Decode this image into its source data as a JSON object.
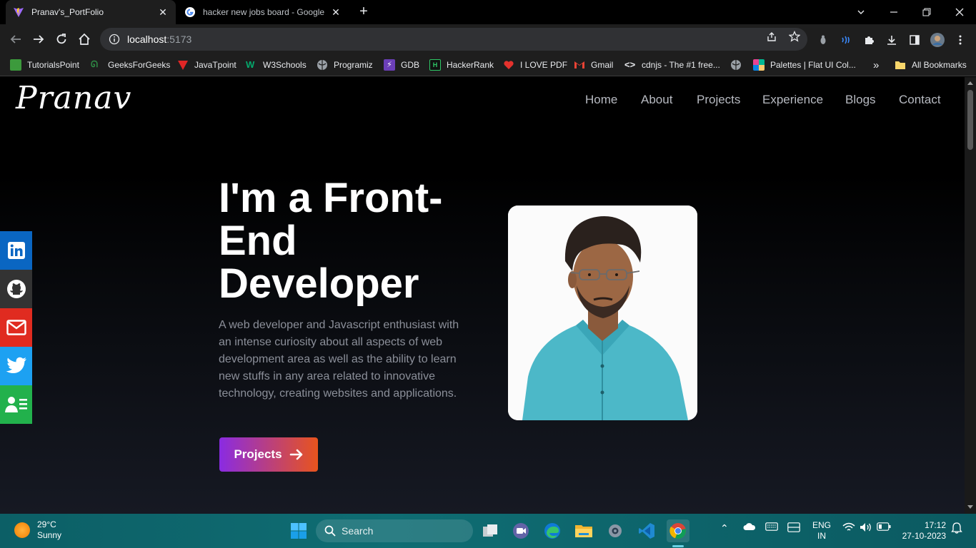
{
  "browser": {
    "tabs": [
      {
        "title": "Pranav's_PortFolio",
        "active": true,
        "favicon": "vite-icon"
      },
      {
        "title": "hacker new jobs board - Google",
        "active": false,
        "favicon": "google-icon"
      }
    ],
    "url_host": "localhost",
    "url_port": ":5173",
    "bookmarks": [
      {
        "label": "TutorialsPoint",
        "icon": "tutorialspoint-icon",
        "color": "#3c9a3c"
      },
      {
        "label": "GeeksForGeeks",
        "icon": "geeksforgeeks-icon",
        "color": "#2f8d46"
      },
      {
        "label": "JavaTpoint",
        "icon": "javatpoint-icon",
        "color": "#e02626"
      },
      {
        "label": "W3Schools",
        "icon": "w3schools-icon",
        "color": "#04aa6d"
      },
      {
        "label": "Programiz",
        "icon": "programiz-icon",
        "color": "#9aa0a6"
      },
      {
        "label": "GDB",
        "icon": "gdb-icon",
        "color": "#6b3fb8"
      },
      {
        "label": "HackerRank",
        "icon": "hackerrank-icon",
        "color": "#1f1f1f"
      },
      {
        "label": "I LOVE PDF",
        "icon": "ilovepdf-icon",
        "color": "#e5322d"
      },
      {
        "label": "Gmail",
        "icon": "gmail-icon",
        "color": "#ea4335"
      },
      {
        "label": "cdnjs - The #1 free...",
        "icon": "cdnjs-icon",
        "color": "#e8eaed"
      },
      {
        "label": "",
        "icon": "globe-icon",
        "color": "#9aa0a6"
      },
      {
        "label": "Palettes | Flat UI Col...",
        "icon": "flatuicolors-icon",
        "color": "#e84393"
      }
    ],
    "bookmarks_overflow": "»",
    "all_bookmarks": "All Bookmarks"
  },
  "site": {
    "logo": "Pranav",
    "nav": [
      "Home",
      "About",
      "Projects",
      "Experience",
      "Blogs",
      "Contact"
    ],
    "hero_title": "I'm a Front-End Developer",
    "hero_description": "A web developer and Javascript enthusiast with an intense curiosity about all aspects of web development area as well as the ability to learn new stuffs in any area related to innovative technology, creating websites and applications.",
    "cta_label": "Projects",
    "social": [
      {
        "name": "linkedin-icon",
        "color": "#0a66c2"
      },
      {
        "name": "github-icon",
        "color": "#333333"
      },
      {
        "name": "mail-icon",
        "color": "#e02b20"
      },
      {
        "name": "twitter-icon",
        "color": "#1da1f2"
      },
      {
        "name": "resume-icon",
        "color": "#22b14c"
      }
    ]
  },
  "taskbar": {
    "temperature": "29°C",
    "condition": "Sunny",
    "search_label": "Search",
    "lang_top": "ENG",
    "lang_bottom": "IN",
    "time": "17:12",
    "date": "27-10-2023"
  }
}
